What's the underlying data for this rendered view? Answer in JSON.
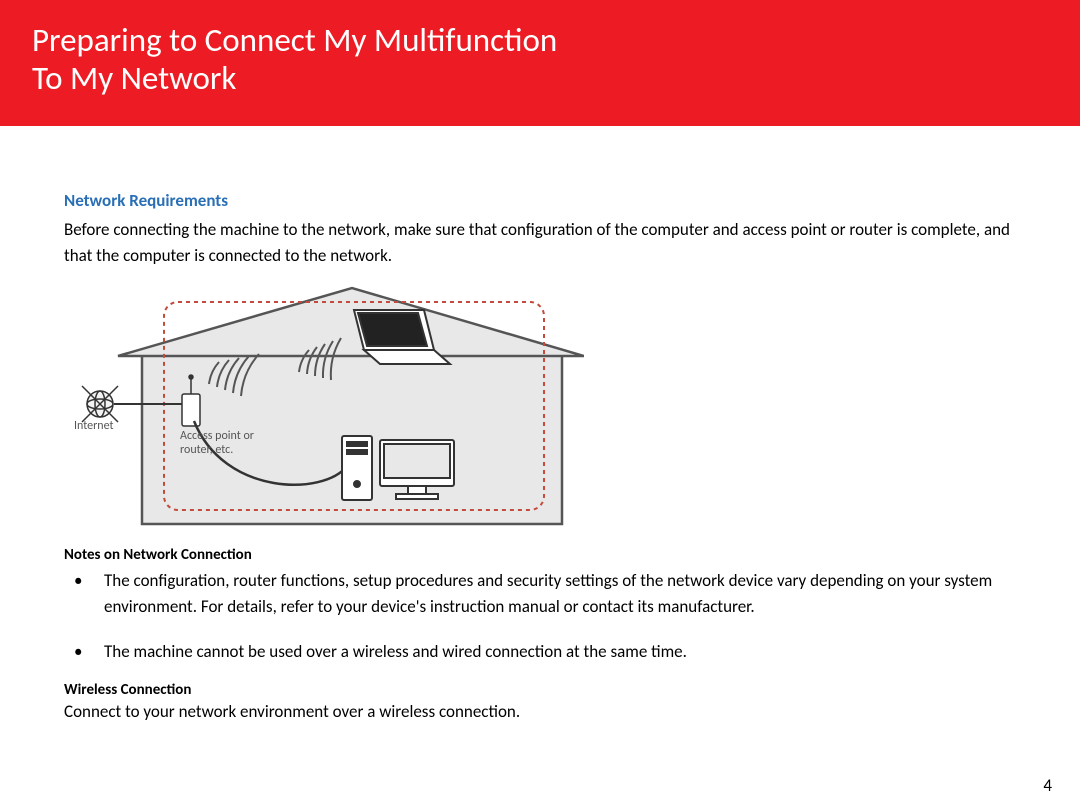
{
  "title_line1": "Preparing to Connect My Multifunction",
  "title_line2": "To My Network",
  "section_header": "Network Requirements",
  "intro_text": "Before connecting the machine to the network, make sure that configuration of the computer and access point or router is complete, and that the computer is connected to the network.",
  "diagram": {
    "internet_label": "Internet",
    "ap_label_line1": "Access point or",
    "ap_label_line2": "router, etc."
  },
  "notes_header": "Notes on Network Connection",
  "notes": [
    "The configuration, router functions, setup procedures and security settings of the network device vary depending on your system environment. For details, refer to your device's instruction manual or contact its manufacturer.",
    "The machine cannot be used over a wireless and wired connection at the same time."
  ],
  "wireless_header": "Wireless Connection",
  "wireless_text": "Connect to your network environment over a wireless connection.",
  "page_number": "4"
}
